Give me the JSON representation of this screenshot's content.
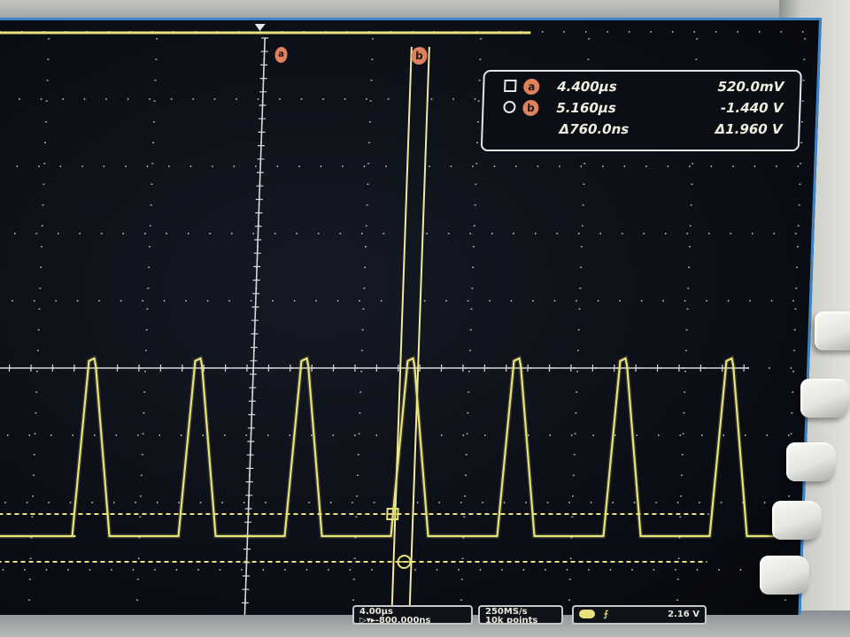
{
  "cursors": {
    "a": {
      "badge": "a",
      "time": "4.400µs",
      "voltage": "520.0mV"
    },
    "b": {
      "badge": "b",
      "time": "5.160µs",
      "voltage": "-1.440 V"
    },
    "delta": {
      "time": "Δ760.0ns",
      "voltage": "Δ1.960 V"
    }
  },
  "cursor_markers": {
    "a_label": "a",
    "b_label": "b"
  },
  "status_bar": {
    "timebase": "4.00µs",
    "delay": "▷▾▸-800.000ns",
    "sample_rate": "250MS/s",
    "record_length": "10k points",
    "trigger_source_icon": "trigger-slope-icon",
    "trigger_level": "2.16 V"
  },
  "colors": {
    "trace": "#e9e27a",
    "graticule": "#d8d8d8",
    "cursor_badge": "#e0805c",
    "screen_border": "#3b84c8"
  },
  "chart_data": {
    "type": "line",
    "series": [
      {
        "name": "",
        "shape": "pulse train",
        "pulse_count_visible": 7,
        "high_level_div": 0.0,
        "low_level_div": -3.6
      }
    ],
    "xlabel": "",
    "ylabel": "",
    "grid": true
  }
}
